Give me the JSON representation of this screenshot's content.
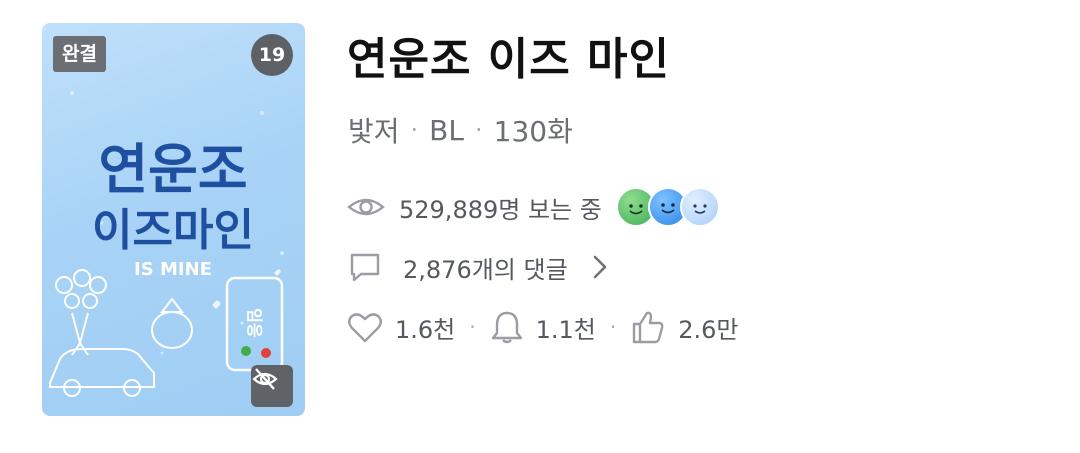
{
  "cover": {
    "badge_complete": "완결",
    "badge_age": "19",
    "title_art_line1": "연운조",
    "title_art_line2": "이즈마인",
    "subtitle_art": "IS MINE",
    "phone_caller": "임응"
  },
  "title": "연운조 이즈 마인",
  "meta": {
    "author": "밫저",
    "genre": "BL",
    "episodes": "130화",
    "separator": "·"
  },
  "views": {
    "text": "529,889명 보는 중",
    "viewer_avatars": [
      "green-face",
      "blue-face",
      "light-blue-face"
    ]
  },
  "comments": {
    "text": "2,876개의 댓글"
  },
  "stats": {
    "likes": "1.6천",
    "subscribers": "1.1천",
    "recommends": "2.6만",
    "separator": "·"
  },
  "colors": {
    "cover_bg": "#a8d3f6",
    "badge_bg": "#6b6f74",
    "text_primary": "#111111",
    "text_secondary": "#55595f"
  }
}
